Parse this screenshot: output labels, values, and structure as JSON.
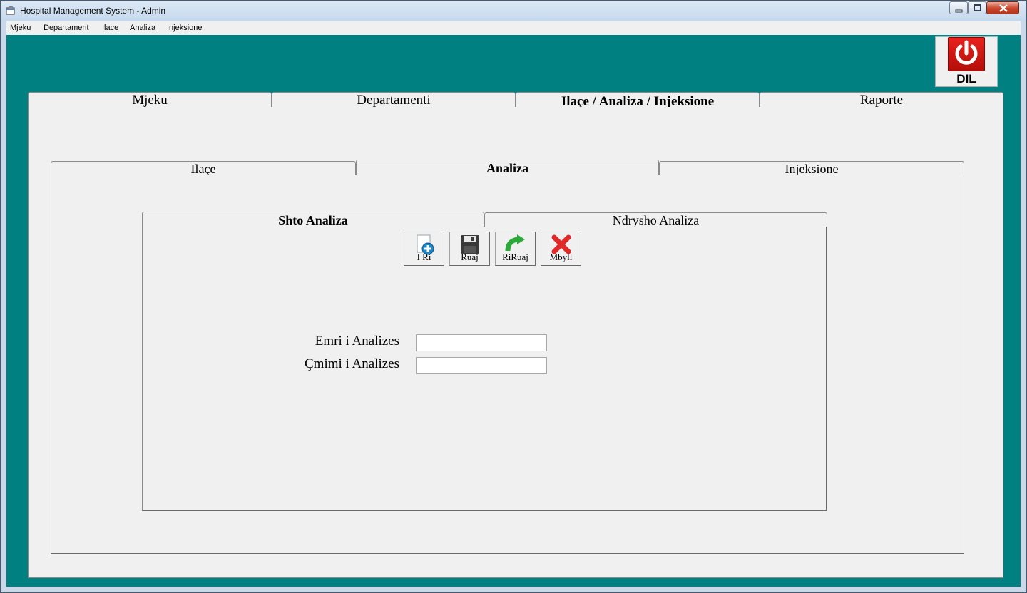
{
  "window": {
    "title": "Hospital Management System - Admin"
  },
  "menu": {
    "items": [
      "Mjeku",
      "Departament",
      "Ilace",
      "Analiza",
      "Injeksione"
    ]
  },
  "exit_button": {
    "label": "DIL",
    "color": "#d7141a"
  },
  "main_tabs": [
    "Mjeku",
    "Departamenti",
    "Ilaçe / Analiza / Injeksione",
    "Raporte"
  ],
  "main_tabs_active": "Ilaçe / Analiza / Injeksione",
  "sub_tabs": [
    "Ilaçe",
    "Analiza",
    "Injeksione"
  ],
  "sub_tabs_active": "Analiza",
  "inner_tabs": [
    "Shto Analiza",
    "Ndrysho Analiza"
  ],
  "inner_tabs_active": "Shto Analiza",
  "toolbar": {
    "new_label": "I Ri",
    "save_label": "Ruaj",
    "resave_label": "RiRuaj",
    "close_label": "Mbyll"
  },
  "form": {
    "name_label": "Emri i Analizes",
    "name_value": "",
    "price_label": "Çmimi i Analizes",
    "price_value": ""
  },
  "colors": {
    "client_background": "#008080",
    "panel_background": "#f0f0f0"
  }
}
